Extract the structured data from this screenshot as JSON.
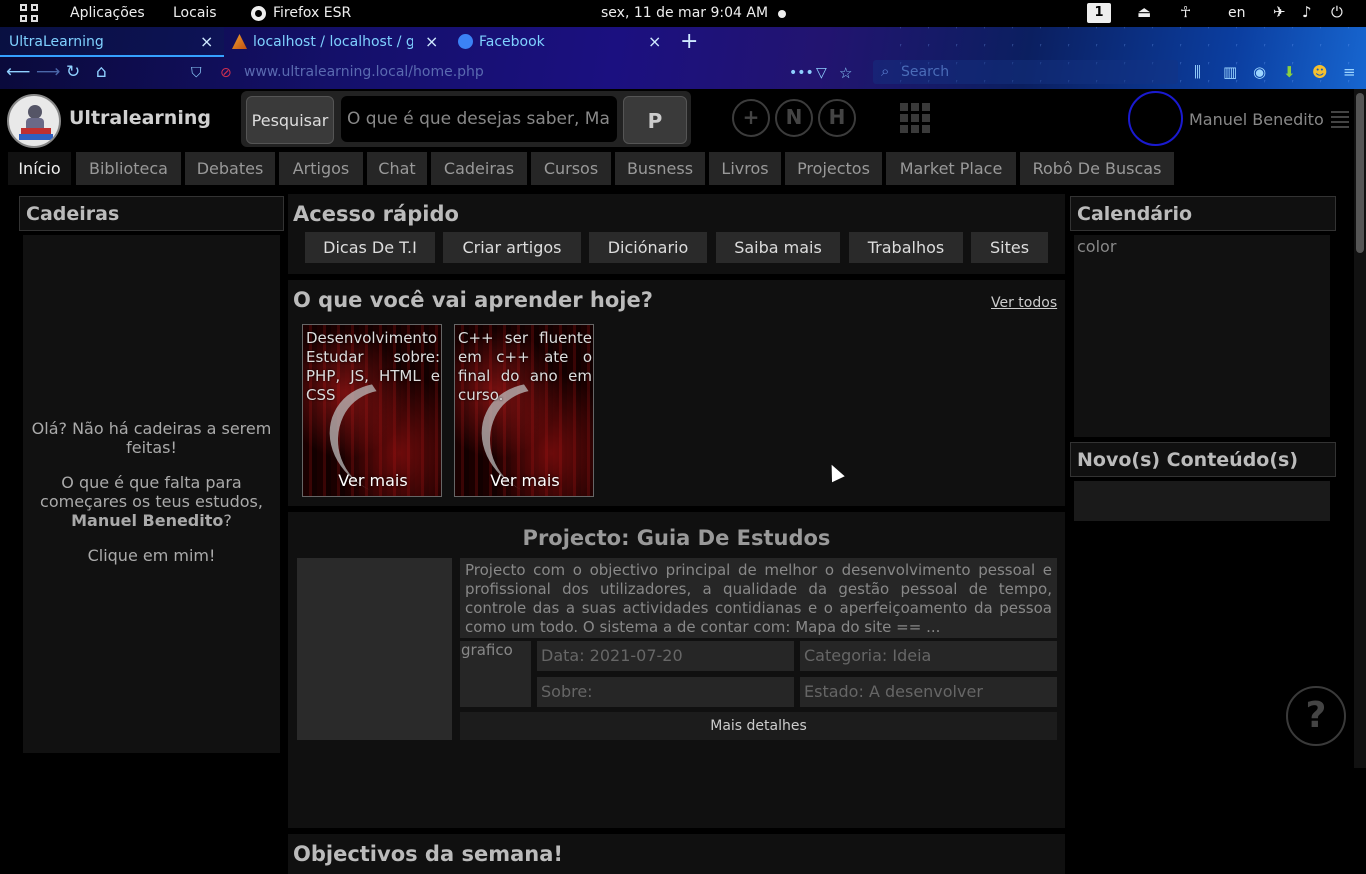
{
  "topbar": {
    "activities": "Aplicações",
    "places": "Locais",
    "app": "Firefox ESR",
    "clock": "sex, 11 de mar  9:04 AM",
    "workspace": "1",
    "lang": "en"
  },
  "browser": {
    "tabs": [
      {
        "title": "UltraLearning",
        "close": "×"
      },
      {
        "title": "localhost / localhost / gui",
        "close": "×"
      },
      {
        "title": "Facebook",
        "close": "×"
      }
    ],
    "new_tab": "+",
    "url": "www.ultralearning.local/home.php",
    "search_placeholder": "Search"
  },
  "site": {
    "brand": "Ultralearning",
    "search": {
      "button": "Pesquisar",
      "placeholder": "O que é que desejas saber, Manuel",
      "p_button": "P"
    },
    "circles": [
      "+",
      "N",
      "H"
    ],
    "user": "Manuel Benedito",
    "nav": [
      "Início",
      "Biblioteca",
      "Debates",
      "Artigos",
      "Chat",
      "Cadeiras",
      "Cursos",
      "Busness",
      "Livros",
      "Projectos",
      "Market Place",
      "Robô De Buscas"
    ]
  },
  "left": {
    "title": "Cadeiras",
    "msg1": "Olá? Não há cadeiras a serem feitas!",
    "msg2a": "O que é que falta para começares os teus estudos,",
    "msg2_name": "Manuel Benedito",
    "msg2b": "?",
    "msg3": "Clique em mim!"
  },
  "acesso": {
    "title": "Acesso rápido",
    "buttons": [
      "Dicas De T.I",
      "Criar artigos",
      "Diciónario",
      "Saiba mais",
      "Trabalhos",
      "Sites"
    ]
  },
  "aprender": {
    "title": "O que você vai aprender hoje?",
    "see_all": "Ver todos",
    "cards": [
      {
        "text": "Desenvolvimento Estudar sobre: PHP, JS, HTML e CSS",
        "more": "Ver mais"
      },
      {
        "text": "C++ ser fluente em c++ ate o final do ano em curso.",
        "more": "Ver mais"
      }
    ]
  },
  "projecto": {
    "title": "Projecto: Guia De Estudos",
    "description": "Projecto com o objectivo principal de melhor o desenvolvimento pessoal e profissional dos utilizadores, a qualidade da gestão pessoal de tempo, controle das a suas actividades contidianas e o aperfeiçoamento da pessoa como um todo. O sistema a de contar com: Mapa do site == ...",
    "grafico": "grafico",
    "data": "Data: 2021-07-20",
    "categoria": "Categoria: Ideia",
    "sobre": "Sobre:",
    "estado": "Estado: A desenvolver",
    "details": "Mais detalhes"
  },
  "objectivos": {
    "title": "Objectivos da semana!"
  },
  "right": {
    "calendar_title": "Calendário",
    "calendar_text": "color",
    "novo_title": "Novo(s) Conteúdo(s)"
  },
  "help": "?",
  "icons": [
    "grid-icon",
    "firefox-icon",
    "back-icon",
    "forward-icon",
    "reload-icon",
    "home-icon",
    "shield-icon",
    "search-icon",
    "library-icon",
    "sidebar-icon",
    "account-icon",
    "download-icon",
    "menu-icon",
    "volume-icon",
    "power-icon",
    "airplane-icon",
    "accessibility-icon",
    "network-icon",
    "apps-grid-icon",
    "hamburger-icon",
    "help-icon"
  ]
}
